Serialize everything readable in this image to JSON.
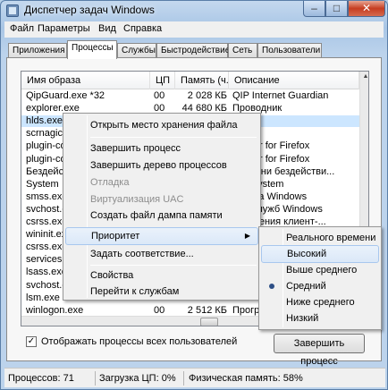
{
  "window": {
    "title": "Диспетчер задач Windows",
    "controls": {
      "minimize": "–",
      "maximize": "□",
      "close": "✕"
    }
  },
  "menubar": {
    "items": [
      "Файл",
      "Параметры",
      "Вид",
      "Справка"
    ]
  },
  "tabs": [
    "Приложения",
    "Процессы",
    "Службы",
    "Быстродействие",
    "Сеть",
    "Пользователи"
  ],
  "active_tab": "Процессы",
  "table": {
    "columns": [
      "Имя образа",
      "ЦП",
      "Память (ч...",
      "Описание"
    ],
    "rows": [
      {
        "name": "QipGuard.exe *32",
        "cpu": "00",
        "mem": "2 028 КБ",
        "desc": "QIP Internet Guardian"
      },
      {
        "name": "explorer.exe",
        "cpu": "00",
        "mem": "44 680 КБ",
        "desc": "Проводник"
      },
      {
        "name": "hlds.exe *",
        "cpu": "",
        "mem": "",
        "desc": "ncher"
      },
      {
        "name": "scrnagic.e",
        "cpu": "",
        "mem": "",
        "desc": ""
      },
      {
        "name": "plugin-conf",
        "cpu": "",
        "mem": "",
        "desc": "ntainer for Firefox"
      },
      {
        "name": "plugin-conf",
        "cpu": "",
        "mem": "",
        "desc": "ntainer for Firefox"
      },
      {
        "name": "Бездейст",
        "cpu": "",
        "mem": "",
        "desc": "времени бездействи..."
      },
      {
        "name": "System",
        "cpu": "",
        "mem": "",
        "desc": "S & System"
      },
      {
        "name": "smss.exe",
        "cpu": "",
        "mem": "",
        "desc": "сеанса Windows"
      },
      {
        "name": "svchost.ex",
        "cpu": "",
        "mem": "",
        "desc": "для служб Windows"
      },
      {
        "name": "csrss.exe",
        "cpu": "",
        "mem": "",
        "desc": "сполнения клиент-..."
      },
      {
        "name": "wininit.exe",
        "cpu": "",
        "mem": "",
        "desc": ""
      },
      {
        "name": "csrss.exe",
        "cpu": "",
        "mem": "",
        "desc": ""
      },
      {
        "name": "services.ex",
        "cpu": "",
        "mem": "",
        "desc": ""
      },
      {
        "name": "lsass.exe",
        "cpu": "",
        "mem": "",
        "desc": ""
      },
      {
        "name": "svchost.ex",
        "cpu": "",
        "mem": "",
        "desc": ""
      },
      {
        "name": "lsm.exe",
        "cpu": "",
        "mem": "",
        "desc": ""
      },
      {
        "name": "winlogon.exe",
        "cpu": "00",
        "mem": "2 512 КБ",
        "desc": "Програ"
      }
    ]
  },
  "show_all_users": {
    "label": "Отображать процессы всех пользователей",
    "checked": "✓"
  },
  "end_process_button": "Завершить процесс",
  "status": {
    "processes": "Процессов: 71",
    "cpu": "Загрузка ЦП: 0%",
    "memory": "Физическая память: 58%"
  },
  "context_menu": {
    "items": [
      "Открыть место хранения файла",
      "Завершить процесс",
      "Завершить дерево процессов",
      "Отладка",
      "Виртуализация UAC",
      "Создать файл дампа памяти",
      "Приоритет",
      "Задать соответствие...",
      "Свойства",
      "Перейти к службам"
    ],
    "submenu_arrow": "▶"
  },
  "priority_submenu": {
    "items": [
      "Реального времени",
      "Высокий",
      "Выше среднего",
      "Средний",
      "Ниже среднего",
      "Низкий"
    ],
    "selected": "Средний",
    "hovered": "Высокий"
  }
}
